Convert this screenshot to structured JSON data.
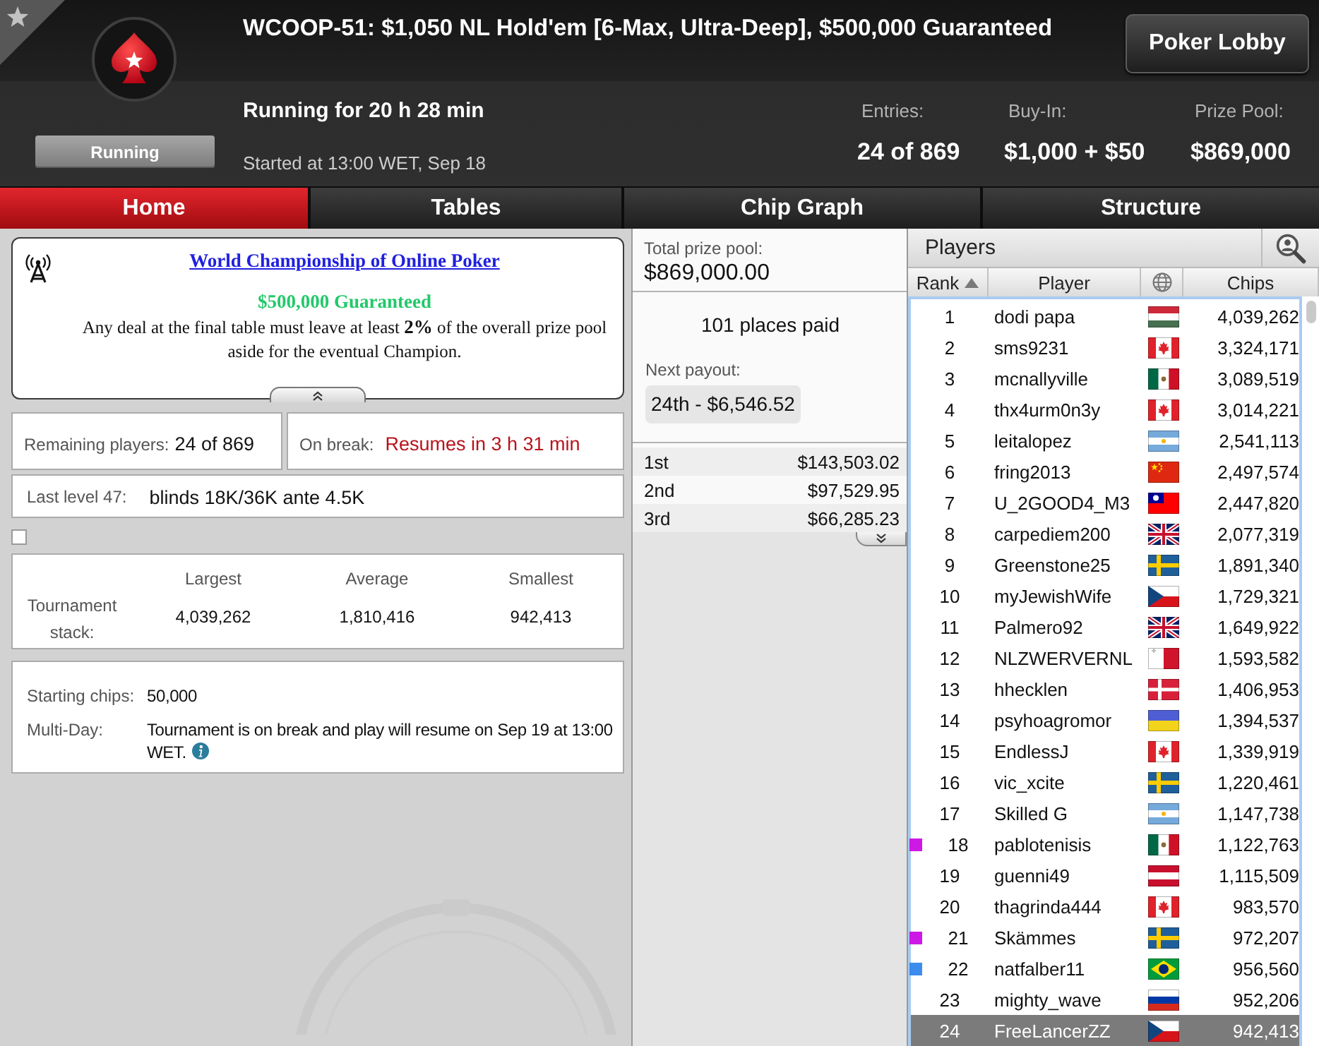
{
  "header": {
    "title": "WCOOP-51: $1,050 NL Hold'em [6-Max, Ultra-Deep], $500,000 Guaranteed",
    "status": "Running",
    "running_for": "Running for 20 h 28 min",
    "started": "Started at 13:00 WET, Sep 18",
    "button": "Poker Lobby",
    "stats": [
      {
        "label": "Entries:",
        "value": "24 of 869"
      },
      {
        "label": "Buy-In:",
        "value": "$1,000 + $50"
      },
      {
        "label": "Prize Pool:",
        "value": "$869,000"
      }
    ]
  },
  "tabs": [
    {
      "label": "Home",
      "selected": true
    },
    {
      "label": "Tables",
      "selected": false
    },
    {
      "label": "Chip Graph",
      "selected": false
    },
    {
      "label": "Structure",
      "selected": false
    }
  ],
  "announcement": {
    "title": "World Championship of Online Poker",
    "guarantee": "$500,000 Guaranteed",
    "text": "Any deal at the final table must leave at least **2%** of the overall prize pool aside for the eventual Champion.",
    "expanded": true
  },
  "remaining": {
    "label": "Remaining players:",
    "value": "24 of 869"
  },
  "break": {
    "label": "On break:",
    "value": "Resumes in 3 h 31 min"
  },
  "last_level": {
    "label": "Last level 47:",
    "value": "blinds 18K/36K ante 4.5K"
  },
  "checkbox": {
    "checked": false
  },
  "stack": {
    "label": "Tournament stack:",
    "columns": [
      {
        "heading": "Largest",
        "value": "4,039,262"
      },
      {
        "heading": "Average",
        "value": "1,810,416"
      },
      {
        "heading": "Smallest",
        "value": "942,413"
      }
    ]
  },
  "details": [
    {
      "label": "Starting chips:",
      "value": "50,000",
      "info": false
    },
    {
      "label": "Multi-Day:",
      "value": "Tournament is on break and play will resume on Sep 19 at 13:00 WET.",
      "info": true
    }
  ],
  "prizes": {
    "total_label": "Total prize pool:",
    "total": "$869,000.00",
    "places_paid": "101 places paid",
    "next_label": "Next payout:",
    "next_payout": "24th - $6,546.52",
    "expanded": false,
    "payouts": [
      {
        "place": "1st",
        "amount": "$143,503.02"
      },
      {
        "place": "2nd",
        "amount": "$97,529.95"
      },
      {
        "place": "3rd",
        "amount": "$66,285.23"
      }
    ]
  },
  "players": {
    "title": "Players",
    "columns": [
      {
        "kind": "text",
        "label": "Rank",
        "sorted": true
      },
      {
        "kind": "text",
        "label": "Player",
        "sorted": false
      },
      {
        "kind": "globe",
        "sorted": false
      },
      {
        "kind": "text",
        "label": "Chips",
        "sorted": false
      }
    ],
    "rows": [
      {
        "rank": "1",
        "name": "dodi papa",
        "kind": "hungary",
        "chips": "4,039,262",
        "selected": false
      },
      {
        "rank": "2",
        "name": "sms9231",
        "kind": "canada",
        "chips": "3,324,171",
        "selected": false
      },
      {
        "rank": "3",
        "name": "mcnallyville",
        "kind": "mexico",
        "chips": "3,089,519",
        "selected": false
      },
      {
        "rank": "4",
        "name": "thx4urm0n3y",
        "kind": "canada",
        "chips": "3,014,221",
        "selected": false
      },
      {
        "rank": "5",
        "name": "leitalopez",
        "kind": "argentina",
        "chips": "2,541,113",
        "selected": false
      },
      {
        "rank": "6",
        "name": "fring2013",
        "kind": "china",
        "chips": "2,497,574",
        "selected": false
      },
      {
        "rank": "7",
        "name": "U_2GOOD4_M3",
        "kind": "taiwan",
        "chips": "2,447,820",
        "selected": false
      },
      {
        "rank": "8",
        "name": "carpediem200",
        "kind": "uk",
        "chips": "2,077,319",
        "selected": false
      },
      {
        "rank": "9",
        "name": "Greenstone25",
        "kind": "sweden",
        "chips": "1,891,340",
        "selected": false
      },
      {
        "rank": "10",
        "name": "myJewishWife",
        "kind": "czechia",
        "chips": "1,729,321",
        "selected": false
      },
      {
        "rank": "11",
        "name": "Palmero92",
        "kind": "uk",
        "chips": "1,649,922",
        "selected": false
      },
      {
        "rank": "12",
        "name": "NLZWERVERNL",
        "kind": "malta",
        "chips": "1,593,582",
        "selected": false
      },
      {
        "rank": "13",
        "name": "hhecklen",
        "kind": "denmark",
        "chips": "1,406,953",
        "selected": false
      },
      {
        "rank": "14",
        "name": "psyhoagromor",
        "kind": "ukraine",
        "chips": "1,394,537",
        "selected": false
      },
      {
        "rank": "15",
        "name": "EndlessJ",
        "kind": "canada",
        "chips": "1,339,919",
        "selected": false
      },
      {
        "rank": "16",
        "name": "vic_xcite",
        "kind": "sweden",
        "chips": "1,220,461",
        "selected": false
      },
      {
        "rank": "17",
        "name": "Skilled G",
        "kind": "argentina",
        "chips": "1,147,738",
        "selected": false
      },
      {
        "rank": "18",
        "name": "pablotenisis",
        "kind": "mexico",
        "chips": "1,122,763",
        "selected": false,
        "color": "#cc19e6"
      },
      {
        "rank": "19",
        "name": "guenni49",
        "kind": "austria",
        "chips": "1,115,509",
        "selected": false
      },
      {
        "rank": "20",
        "name": "thagrinda444",
        "kind": "canada",
        "chips": "983,570",
        "selected": false
      },
      {
        "rank": "21",
        "name": "Skämmes",
        "kind": "sweden",
        "chips": "972,207",
        "selected": false,
        "color": "#cc19e6"
      },
      {
        "rank": "22",
        "name": "natfalber11",
        "kind": "brazil",
        "chips": "956,560",
        "selected": false,
        "color": "#3b8ced"
      },
      {
        "rank": "23",
        "name": "mighty_wave",
        "kind": "russia",
        "chips": "952,206",
        "selected": false
      },
      {
        "rank": "24",
        "name": "FreeLancerZZ",
        "kind": "czechia",
        "chips": "942,413",
        "selected": true
      }
    ]
  }
}
